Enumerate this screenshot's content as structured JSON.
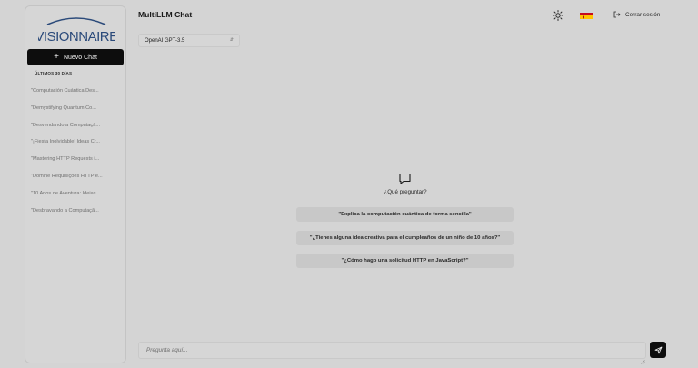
{
  "brand": {
    "logo_text": "VISIONNAIRE"
  },
  "sidebar": {
    "new_chat_label": "Nuevo Chat",
    "section_label": "ÚLTIMOS 30 DÍAS",
    "history": [
      "\"Computación Cuántica Des...",
      "\"Demystifying Quantum Co...",
      "\"Desvendando a Computaçã...",
      "\"¡Fiesta Inolvidable! Ideas Cr...",
      "\"Mastering HTTP Requests i...",
      "\"Domine Requisições HTTP e...",
      "\"10 Anos de Aventura: Ideias ...",
      "\"Desbravando a Computaçã..."
    ]
  },
  "header": {
    "title": "MultiLLM Chat",
    "logout_label": "Cerrar sesión",
    "theme_icon": "sun-icon",
    "language_icon": "flag-spain-icon"
  },
  "model": {
    "selected": "OpenAI GPT-3.5"
  },
  "center": {
    "icon": "chat-bubble-icon",
    "prompt": "¿Qué preguntar?",
    "suggestions": [
      "\"Explica la computación cuántica de forma sencilla\"",
      "\"¿Tienes alguna idea creativa para el cumpleaños de un niño de 10 años?\"",
      "\"¿Cómo hago una solicitud HTTP en JavaScript?\""
    ]
  },
  "composer": {
    "placeholder": "Pregunta aquí..."
  },
  "colors": {
    "background": "#d4d4d4",
    "sidebar": "#d6d6d6",
    "button_dark": "#0d0d0d",
    "suggestion_bg": "#c8c8c8",
    "logo_blue": "#2b4a7a",
    "flag_red": "#c60b1e",
    "flag_yellow": "#ffc400"
  }
}
